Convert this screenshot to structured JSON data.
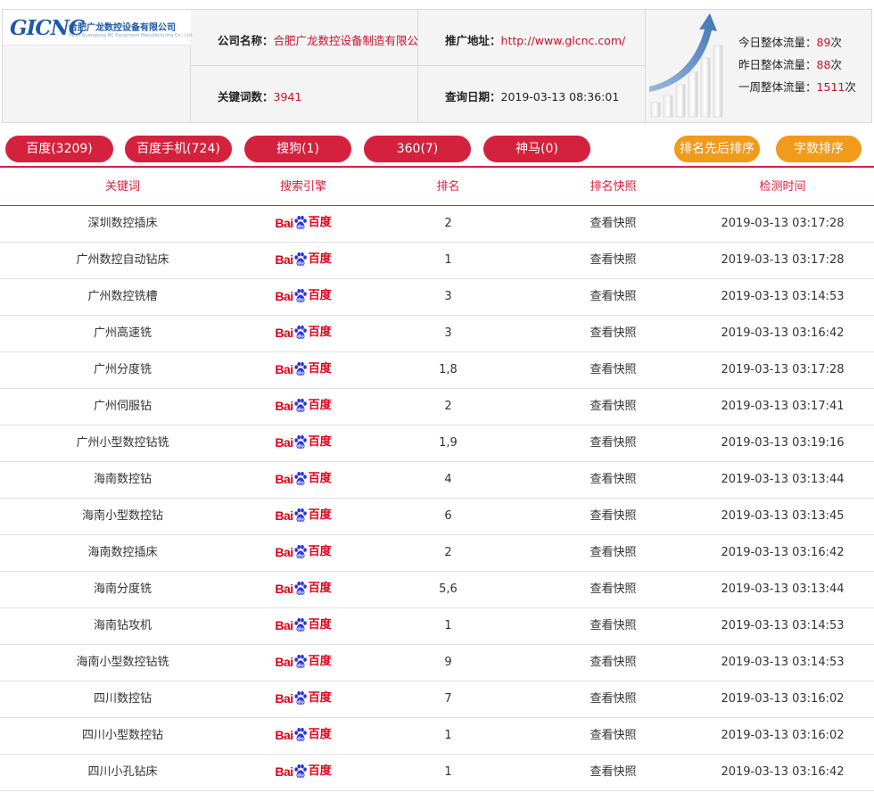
{
  "header": {
    "logo_mark": "GICNC",
    "logo_name": "合肥广龙数控设备有限公司",
    "logo_sub": "Hefei Guanglong NC Equipment Manufacturing Co., Ltd.",
    "company_label": "公司名称：",
    "company_value": "合肥广龙数控设备制造有限公",
    "promo_label": "推广地址：",
    "promo_value": "http://www.glcnc.com/",
    "keywords_label": "关键词数：",
    "keywords_value": "3941",
    "query_label": "查询日期：",
    "query_value": "2019-03-13 08:36:01"
  },
  "stats": {
    "today_label": "今日整体流量：",
    "today_value": "89",
    "yesterday_label": "昨日整体流量：",
    "yesterday_value": "88",
    "week_label": "一周整体流量：",
    "week_value": "1511",
    "unit": "次"
  },
  "tabs": [
    {
      "label": "百度(3209)"
    },
    {
      "label": "百度手机(724)"
    },
    {
      "label": "搜狗(1)"
    },
    {
      "label": "360(7)"
    },
    {
      "label": "神马(0)"
    }
  ],
  "sort_buttons": [
    {
      "label": "排名先后排序"
    },
    {
      "label": "字数排序"
    }
  ],
  "table": {
    "headers": [
      "关键词",
      "搜索引擎",
      "排名",
      "排名快照",
      "检测时间"
    ],
    "engine_logo": {
      "bai": "Bai",
      "du": "百度",
      "icon": "baidu-paw-icon"
    },
    "rows": [
      {
        "keyword": "深圳数控插床",
        "rank": "2",
        "snapshot": "查看快照",
        "time": "2019-03-13 03:17:28"
      },
      {
        "keyword": "广州数控自动钻床",
        "rank": "1",
        "snapshot": "查看快照",
        "time": "2019-03-13 03:17:28"
      },
      {
        "keyword": "广州数控铣槽",
        "rank": "3",
        "snapshot": "查看快照",
        "time": "2019-03-13 03:14:53"
      },
      {
        "keyword": "广州高速铣",
        "rank": "3",
        "snapshot": "查看快照",
        "time": "2019-03-13 03:16:42"
      },
      {
        "keyword": "广州分度铣",
        "rank": "1,8",
        "snapshot": "查看快照",
        "time": "2019-03-13 03:17:28"
      },
      {
        "keyword": "广州伺服钻",
        "rank": "2",
        "snapshot": "查看快照",
        "time": "2019-03-13 03:17:41"
      },
      {
        "keyword": "广州小型数控钻铣",
        "rank": "1,9",
        "snapshot": "查看快照",
        "time": "2019-03-13 03:19:16"
      },
      {
        "keyword": "海南数控钻",
        "rank": "4",
        "snapshot": "查看快照",
        "time": "2019-03-13 03:13:44"
      },
      {
        "keyword": "海南小型数控钻",
        "rank": "6",
        "snapshot": "查看快照",
        "time": "2019-03-13 03:13:45"
      },
      {
        "keyword": "海南数控插床",
        "rank": "2",
        "snapshot": "查看快照",
        "time": "2019-03-13 03:16:42"
      },
      {
        "keyword": "海南分度铣",
        "rank": "5,6",
        "snapshot": "查看快照",
        "time": "2019-03-13 03:13:44"
      },
      {
        "keyword": "海南钻攻机",
        "rank": "1",
        "snapshot": "查看快照",
        "time": "2019-03-13 03:14:53"
      },
      {
        "keyword": "海南小型数控钻铣",
        "rank": "9",
        "snapshot": "查看快照",
        "time": "2019-03-13 03:14:53"
      },
      {
        "keyword": "四川数控钻",
        "rank": "7",
        "snapshot": "查看快照",
        "time": "2019-03-13 03:16:02"
      },
      {
        "keyword": "四川小型数控钻",
        "rank": "1",
        "snapshot": "查看快照",
        "time": "2019-03-13 03:16:02"
      },
      {
        "keyword": "四川小孔钻床",
        "rank": "1",
        "snapshot": "查看快照",
        "time": "2019-03-13 03:16:42"
      }
    ]
  },
  "colors": {
    "accent_red": "#d4213d",
    "value_red": "#c8102e",
    "sort_orange": "#f29a1a",
    "logo_blue": "#1e5aa8"
  }
}
